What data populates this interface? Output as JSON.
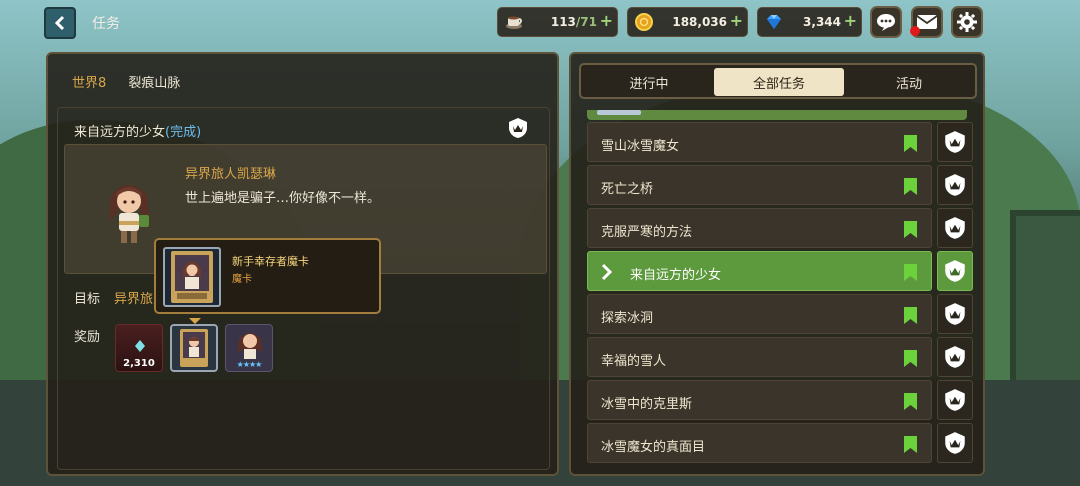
{
  "header": {
    "title": "任务",
    "resources": {
      "stamina": {
        "current": "113",
        "max": "/71",
        "icon": "coffee-cup-icon"
      },
      "gold": {
        "value": "188,036",
        "icon": "gold-coin-icon"
      },
      "gems": {
        "value": "3,344",
        "icon": "diamond-icon"
      }
    },
    "plus": "+",
    "buttons": [
      "chat-icon",
      "mail-icon",
      "settings-icon"
    ],
    "mail_has_notification": true
  },
  "quest_detail": {
    "world": "世界8",
    "region": "裂痕山脉",
    "title": "来自远方的少女",
    "status": "(完成)",
    "speaker": "异界旅人凯瑟琳",
    "dialogue": "世上遍地是骗子…你好像不一样。",
    "goal_label": "目标",
    "goal_text": "异界旅人凯瑟琳",
    "reward_label": "奖励",
    "rewards": [
      {
        "type": "gem",
        "count": "2,310"
      },
      {
        "type": "card"
      },
      {
        "type": "character",
        "stars": "★★★★"
      }
    ],
    "tooltip": {
      "name": "新手幸存者魔卡",
      "type": "魔卡"
    }
  },
  "quest_list": {
    "tabs": [
      "进行中",
      "全部任务",
      "活动"
    ],
    "active_tab": 1,
    "items": [
      {
        "name": "雪山冰雪魔女",
        "active": false
      },
      {
        "name": "死亡之桥",
        "active": false
      },
      {
        "name": "克服严寒的方法",
        "active": false
      },
      {
        "name": "来自远方的少女",
        "active": true
      },
      {
        "name": "探索冰洞",
        "active": false
      },
      {
        "name": "幸福的雪人",
        "active": false
      },
      {
        "name": "冰雪中的克里斯",
        "active": false
      },
      {
        "name": "冰雪魔女的真面目",
        "active": false
      }
    ]
  },
  "colors": {
    "accent_gold": "#d9a64a",
    "complete_blue": "#6dbcea",
    "active_green": "#5c9a3d",
    "bookmark_green": "#6cd23c"
  }
}
